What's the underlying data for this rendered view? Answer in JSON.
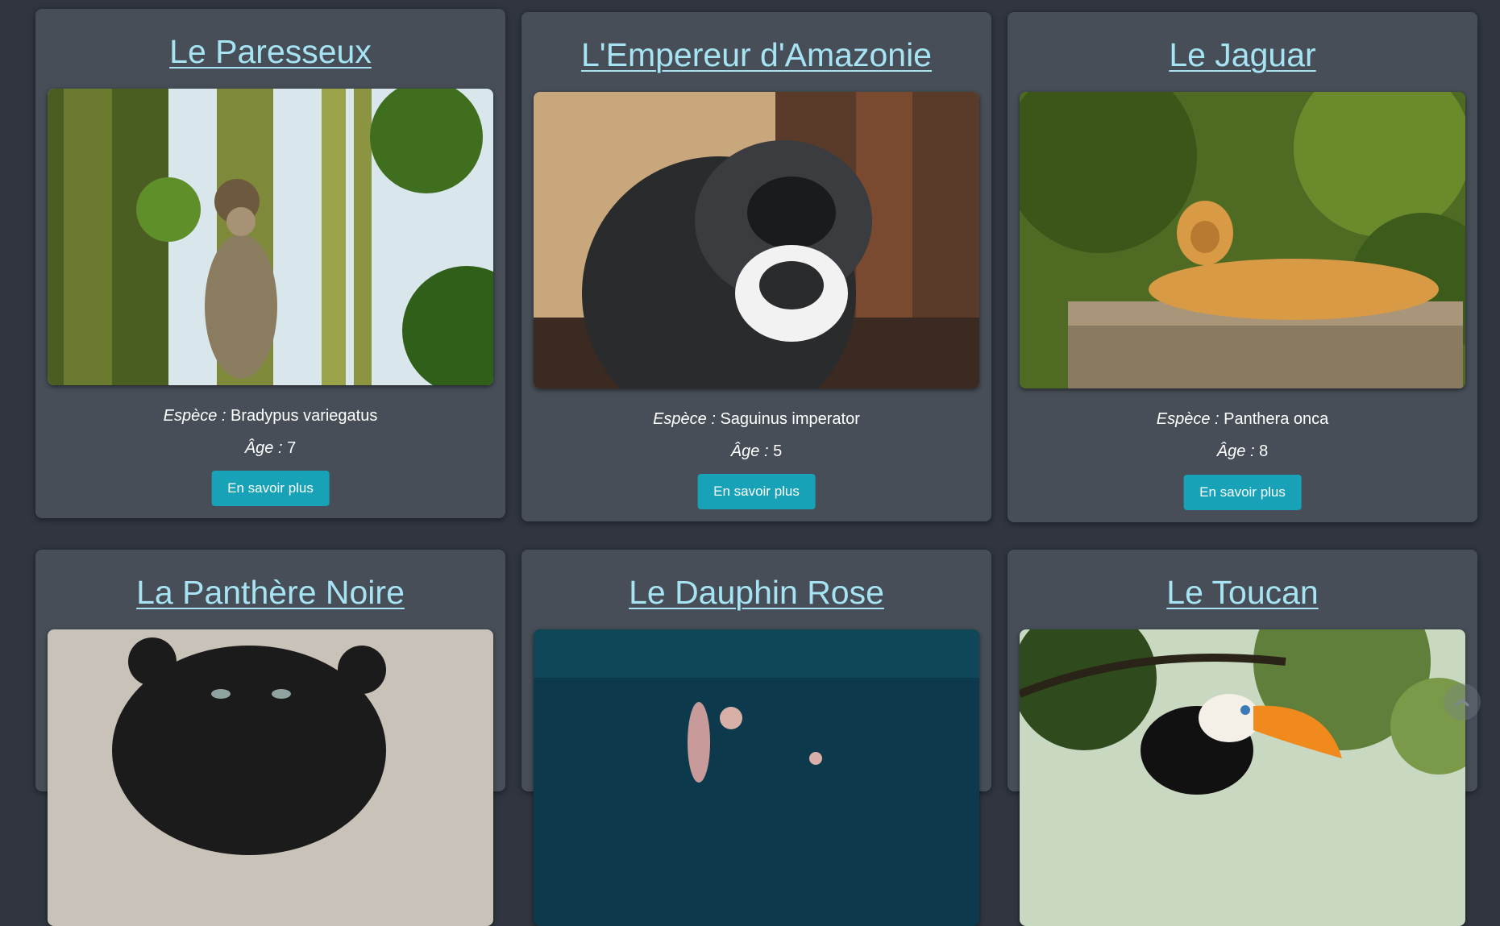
{
  "cards": [
    {
      "title": "Le Paresseux",
      "species_label": "Espèce :",
      "species": "Bradypus variegatus",
      "age_label": "Âge :",
      "age": "7",
      "button": "En savoir plus"
    },
    {
      "title": "L'Empereur d'Amazonie",
      "species_label": "Espèce :",
      "species": "Saguinus imperator",
      "age_label": "Âge :",
      "age": "5",
      "button": "En savoir plus"
    },
    {
      "title": "Le Jaguar",
      "species_label": "Espèce :",
      "species": "Panthera onca",
      "age_label": "Âge :",
      "age": "8",
      "button": "En savoir plus"
    },
    {
      "title": "La Panthère Noire"
    },
    {
      "title": "Le Dauphin Rose"
    },
    {
      "title": "Le Toucan"
    }
  ],
  "colors": {
    "background": "#30353f",
    "card": "#474e57",
    "link": "#a6e4f4",
    "button": "#17a2b8"
  },
  "scroll_top_icon": "chevron-up-icon"
}
